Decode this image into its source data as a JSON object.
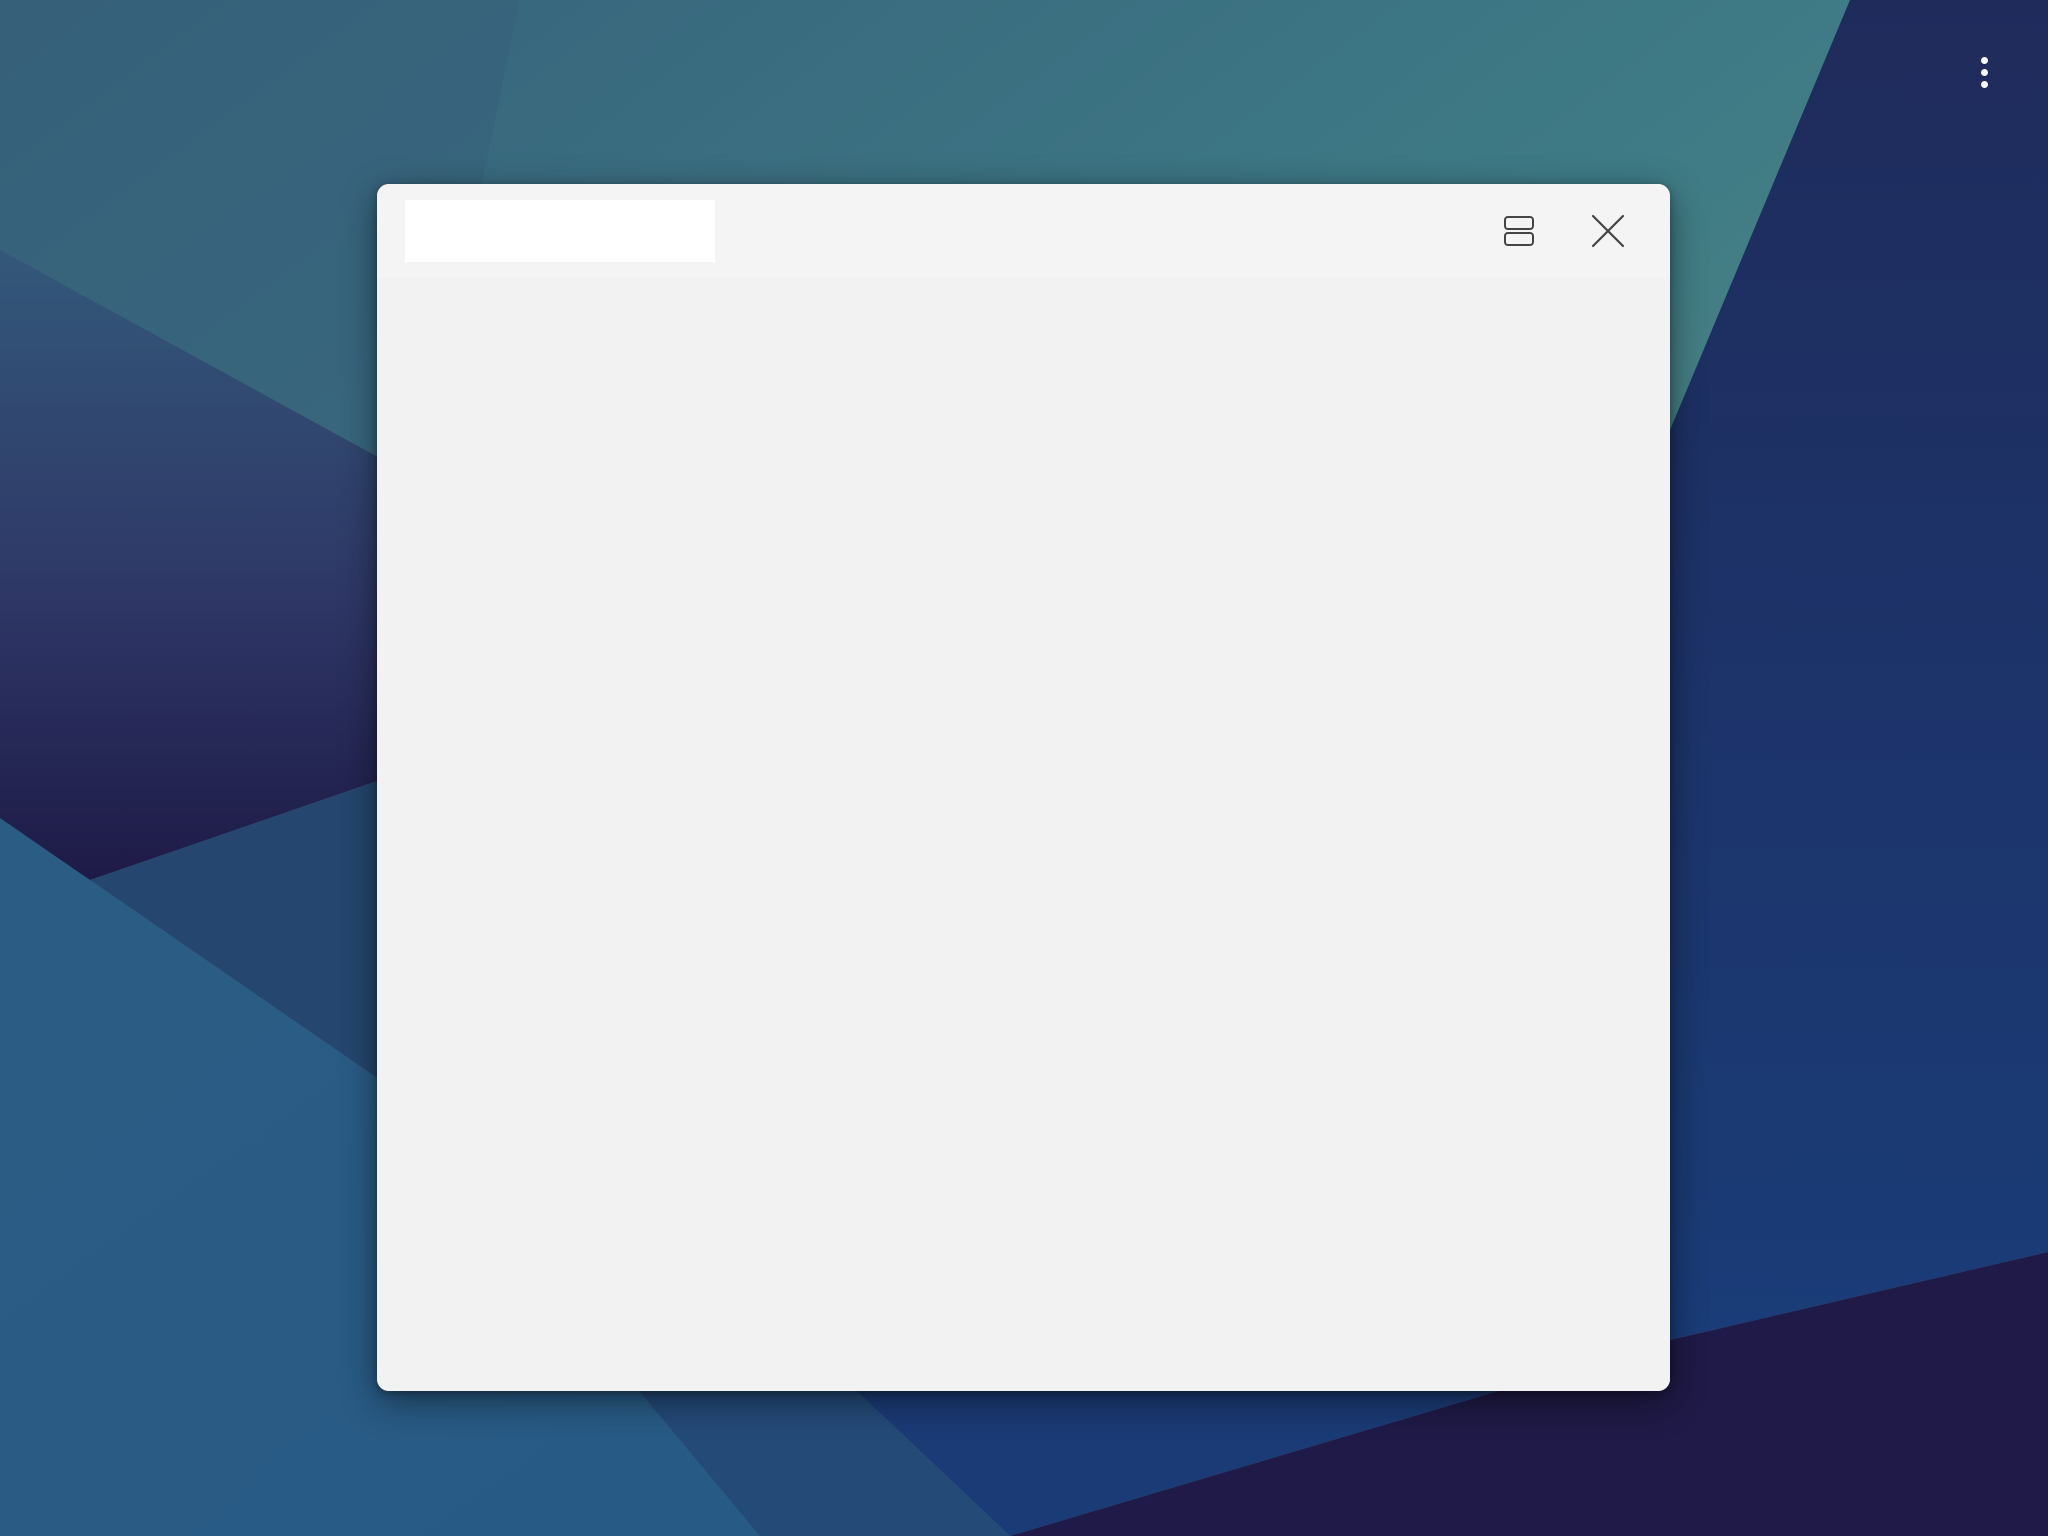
{
  "desktop": {
    "overflow_menu_icon": "more-vertical-icon",
    "colors": {
      "deep_navy": "#1f1a47",
      "dark_blue": "#1e2a5a",
      "teal": "#3f7e86",
      "sage_green": "#5e8f7a",
      "mid_blue": "#2b5b85",
      "bright_blue": "#1b3c78"
    }
  },
  "window": {
    "title": "",
    "split_view_icon": "split-view-icon",
    "close_icon": "close-icon",
    "content": "",
    "colors": {
      "background": "#f2f2f2",
      "titlebar": "#f4f4f4",
      "title_field": "#ffffff",
      "icon_stroke": "#444444"
    }
  }
}
